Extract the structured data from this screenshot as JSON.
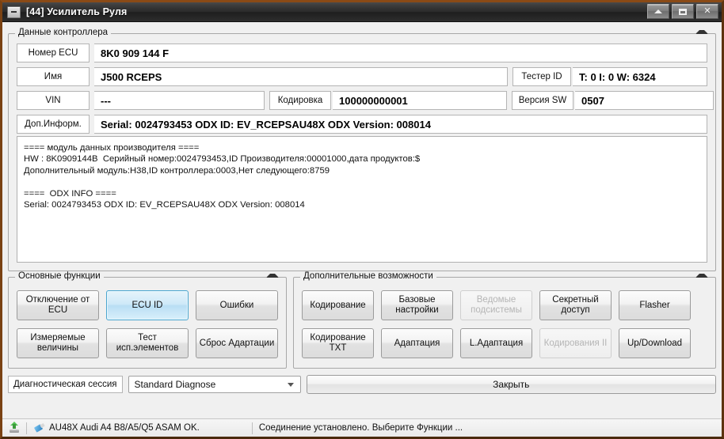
{
  "window": {
    "title": "[44] Усилитель Руля",
    "icon": "window-restore-icon",
    "buttons": {
      "minimize": "minimize-icon",
      "maximize": "maximize-icon",
      "close": "✕"
    }
  },
  "controller_group": {
    "title": "Данные контроллера",
    "fields": {
      "ecu_number_label": "Номер ECU",
      "ecu_number_value": "8K0 909 144 F",
      "name_label": "Имя",
      "name_value": "J500  RCEPS",
      "tester_id_label": "Тестер ID",
      "tester_id_value": "T: 0 I: 0 W: 6324",
      "vin_label": "VIN",
      "vin_value": "---",
      "coding_label": "Кодировка",
      "coding_value": "100000000001",
      "sw_version_label": "Версия SW",
      "sw_version_value": "0507",
      "extra_info_label": "Доп.Информ.",
      "extra_info_value": "Serial: 0024793453 ODX ID: EV_RCEPSAU48X ODX Version: 008014"
    },
    "memo": "==== модуль данных производителя ====\nHW : 8K0909144B  Серийный номер:0024793453,ID Производителя:00001000,дата продуктов:$\nДополнительный модуль:H38,ID контроллера:0003,Нет следующего:8759\n\n====  ODX INFO ====\nSerial: 0024793453 ODX ID: EV_RCEPSAU48X ODX Version: 008014"
  },
  "main_functions": {
    "title": "Основные функции",
    "buttons": [
      {
        "label": "Отключение от ECU",
        "state": "normal"
      },
      {
        "label": "ECU ID",
        "state": "selected"
      },
      {
        "label": "Ошибки",
        "state": "normal"
      },
      {
        "label": "Измеряемые величины",
        "state": "normal"
      },
      {
        "label": "Тест исп.элементов",
        "state": "normal"
      },
      {
        "label": "Сброс Адартации",
        "state": "normal"
      }
    ]
  },
  "extra_functions": {
    "title": "Дополнительные возможности",
    "buttons": [
      {
        "label": "Кодирование",
        "state": "normal"
      },
      {
        "label": "Базовые настройки",
        "state": "normal"
      },
      {
        "label": "Ведомые подсистемы",
        "state": "disabled"
      },
      {
        "label": "Секретный доступ",
        "state": "normal"
      },
      {
        "label": "Flasher",
        "state": "normal"
      },
      {
        "label": "Кодирование TXT",
        "state": "normal"
      },
      {
        "label": "Адаптация",
        "state": "normal"
      },
      {
        "label": "L.Адаптация",
        "state": "normal"
      },
      {
        "label": "Кодирования II",
        "state": "disabled"
      },
      {
        "label": "Up/Download",
        "state": "normal"
      }
    ]
  },
  "session": {
    "label": "Диагностическая сессия",
    "selected": "Standard Diagnose",
    "options": [
      "Standard Diagnose"
    ],
    "close_label": "Закрыть"
  },
  "statusbar": {
    "upload_icon": "upload-icon",
    "plug_icon": "plug-icon",
    "device_text": "AU48X Audi A4 B8/A5/Q5 ASAM OK.",
    "connection_text": "Соединение установлено. Выберите Функции ..."
  },
  "colors": {
    "accent_selected": "#b9def4",
    "accent_border": "#4ba6cf",
    "frame": "#8a4a16",
    "titlebar": "#2a2a2a"
  }
}
